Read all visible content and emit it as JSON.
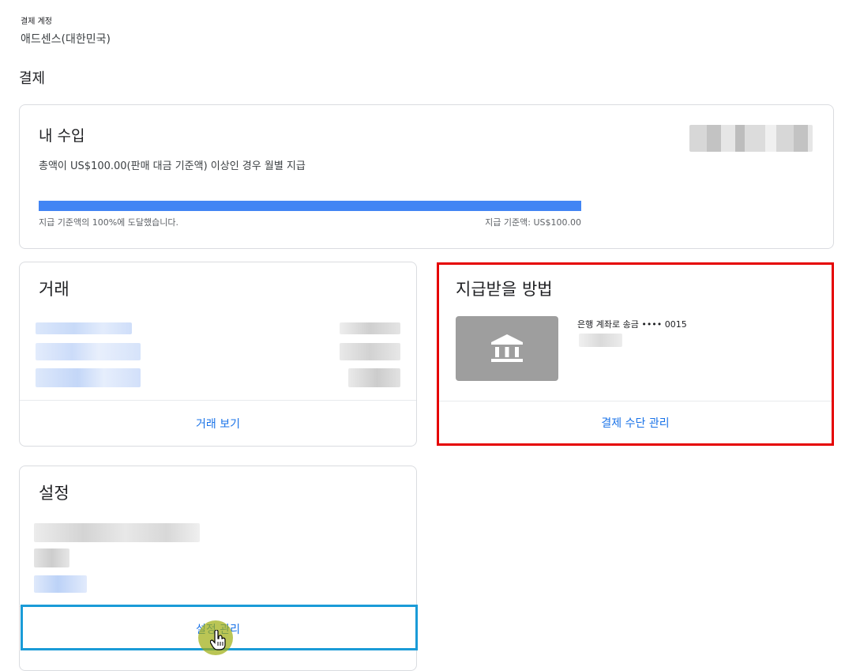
{
  "account": {
    "label": "결제 계정",
    "name": "애드센스(대한민국)"
  },
  "page": {
    "section_title": "결제"
  },
  "earnings": {
    "title": "내 수입",
    "description": "총액이 US$100.00(판매 대금 기준액) 이상인 경우 월별 지급",
    "progress_percent": 100,
    "progress_left_text": "지급 기준액의 100%에 도달했습니다.",
    "progress_right_text": "지급 기준액: US$100.00",
    "progress_color": "#4285f4"
  },
  "transactions": {
    "title": "거래",
    "footer_link": "거래 보기"
  },
  "payment_method": {
    "title": "지급받을 방법",
    "bank_label": "은행 계좌로 송금 •••• 0015",
    "icon": "bank-icon",
    "footer_link": "결제 수단 관리"
  },
  "settings": {
    "title": "설정",
    "footer_link": "설정 관리"
  },
  "colors": {
    "link": "#1a73e8",
    "highlight_red": "#e50000",
    "highlight_blue": "#1a9bd7"
  }
}
